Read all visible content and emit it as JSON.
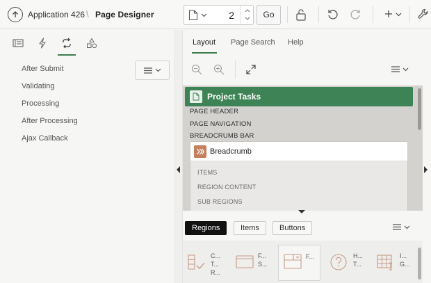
{
  "header": {
    "app_title": "Application 426",
    "separator": "\\",
    "page_designer_label": "Page Designer",
    "page_number": "2",
    "go_label": "Go",
    "icons": [
      "up-arrow-circle-icon",
      "document-icon",
      "chevron-down-icon",
      "lock-icon",
      "undo-icon",
      "redo-icon",
      "plus-icon",
      "wrench-icon"
    ]
  },
  "left_pane": {
    "tab_icons": [
      "rendering-tree-icon",
      "lightning-icon",
      "processing-icon",
      "shared-components-icon"
    ],
    "active_tab": 2,
    "items": [
      "After Submit",
      "Validating",
      "Processing",
      "After Processing",
      "Ajax Callback"
    ]
  },
  "center_pane": {
    "tabs": [
      "Layout",
      "Page Search",
      "Help"
    ],
    "active_tab": "Layout",
    "page_title": "Project Tasks",
    "positions": [
      "PAGE HEADER",
      "PAGE NAVIGATION",
      "BREADCRUMB BAR"
    ],
    "region": {
      "name": "Breadcrumb",
      "sub_positions": [
        "ITEMS",
        "REGION CONTENT",
        "SUB REGIONS"
      ]
    },
    "gallery_tabs": [
      "Regions",
      "Items",
      "Buttons"
    ],
    "gallery_active": "Regions",
    "gallery_items": [
      {
        "icon": "checklist-icon",
        "lines": [
          "C...",
          "T...",
          "R..."
        ]
      },
      {
        "icon": "window-icon",
        "lines": [
          "F...",
          "S..."
        ]
      },
      {
        "icon": "form-region-icon",
        "lines": [
          "F..."
        ]
      },
      {
        "icon": "help-icon",
        "lines": [
          "H...",
          "T..."
        ]
      },
      {
        "icon": "grid-icon",
        "lines": [
          "I...",
          "G..."
        ]
      }
    ]
  },
  "colors": {
    "accent": "#3e8355",
    "region_icon": "#c47f5b",
    "canvas": "#d3d2cf"
  }
}
